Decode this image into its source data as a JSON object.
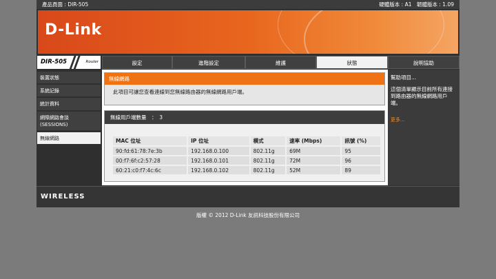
{
  "topbar": {
    "product": "產品頁面 : DIR-505",
    "versions": "硬體版本 : A1　韌體版本 : 1.09"
  },
  "banner": {
    "logo": "D-Link"
  },
  "model": {
    "name": "DIR-505",
    "type": "Router"
  },
  "tabs": [
    {
      "label": "設定",
      "active": false
    },
    {
      "label": "進階設定",
      "active": false
    },
    {
      "label": "維護",
      "active": false
    },
    {
      "label": "狀態",
      "active": true
    },
    {
      "label": "說明協助",
      "active": false
    }
  ],
  "sidebar": {
    "items": [
      {
        "label": "裝置狀態"
      },
      {
        "label": "系統記錄"
      },
      {
        "label": "統計資料"
      },
      {
        "label": "網際網路會談",
        "label2": "(SESSIONS)"
      },
      {
        "label": "無線網路",
        "active": true
      }
    ]
  },
  "wireless_panel": {
    "title": "無線網路",
    "description": "此項目可讓您查看連線到您無線路由器的無線網路用戶端。"
  },
  "client_list": {
    "header": "無線用戶端數量　：　3",
    "columns": [
      "MAC 位址",
      "IP 位址",
      "模式",
      "速率 (Mbps)",
      "訊號 (%)"
    ],
    "rows": [
      [
        "90:fd:61:78:7e:3b",
        "192.168.0.100",
        "802.11g",
        "69M",
        "95"
      ],
      [
        "00:f7:6f:c2:57:28",
        "192.168.0.101",
        "802.11g",
        "72M",
        "96"
      ],
      [
        "60:21:c0:f7:4c:6c",
        "192.168.0.102",
        "802.11g",
        "52M",
        "89"
      ]
    ]
  },
  "help": {
    "title": "幫助項目...",
    "text": "這個清單顯示目前所有連接到路由器的無線網路用戶端。",
    "more": "更多..."
  },
  "footer": {
    "brand": "WIRELESS"
  },
  "copyright": "版權 © 2012 D-Link 友訊科技股份有限公司"
}
